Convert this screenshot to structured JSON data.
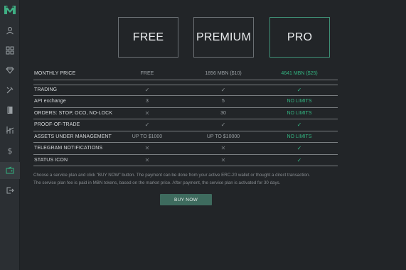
{
  "colors": {
    "accent": "#33b380",
    "background": "#222528",
    "sidebar": "#2b2f33",
    "button": "#3e6b5e"
  },
  "sidebar": {
    "items": [
      {
        "icon": "user-icon"
      },
      {
        "icon": "grid-icon"
      },
      {
        "icon": "diamond-icon"
      },
      {
        "icon": "wrench-icon"
      },
      {
        "icon": "book-icon"
      },
      {
        "icon": "chart-icon"
      },
      {
        "icon": "dollar-icon"
      },
      {
        "icon": "wallet-icon"
      },
      {
        "icon": "logout-icon"
      }
    ],
    "active_index": 7
  },
  "plans": [
    {
      "name": "FREE"
    },
    {
      "name": "PREMIUM"
    },
    {
      "name": "PRO"
    }
  ],
  "table": {
    "price_row": {
      "label": "MONTHLY PRICE",
      "values": [
        "FREE",
        "1856 MBN ($10)",
        "4641 MBN ($25)"
      ]
    },
    "rows": [
      {
        "label": "TRADING",
        "values": [
          "check",
          "check",
          "check"
        ]
      },
      {
        "label": "API exchange",
        "values": [
          "3",
          "5",
          "NO LIMITS"
        ]
      },
      {
        "label": "ORDERS: STOP, OCO, NO-LOCK",
        "values": [
          "cross",
          "30",
          "NO LIMITS"
        ]
      },
      {
        "label": "PROOF-OF-TRADE",
        "values": [
          "check",
          "check",
          "check"
        ]
      },
      {
        "label": "ASSETS UNDER MANAGEMENT",
        "values": [
          "UP TO $1000",
          "UP TO $10000",
          "NO LIMITS"
        ]
      },
      {
        "label": "TELEGRAM NOTIFICATIONS",
        "values": [
          "cross",
          "cross",
          "check"
        ]
      },
      {
        "label": "STATUS ICON",
        "values": [
          "cross",
          "cross",
          "check"
        ]
      }
    ]
  },
  "note": {
    "line1": "Choose a service plan and click \"BUY NOW\" button. The payment can be done from your active ERC-20 wallet or thought a direct transaction.",
    "line2": "The service plan fee is paid in MBN tokens, based on the market price. After payment, the service plan is activated for 30 days."
  },
  "buy_button": {
    "label": "BUY NOW"
  }
}
